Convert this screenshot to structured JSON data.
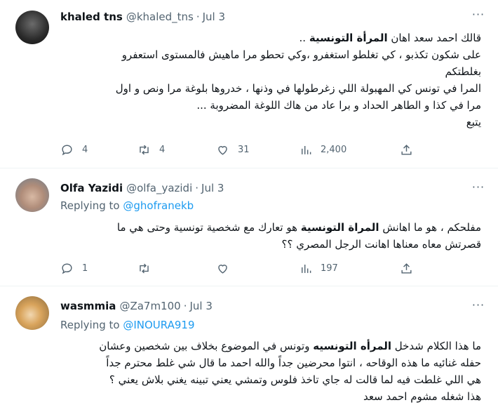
{
  "tweets": [
    {
      "name": "khaled tns",
      "handle": "@khaled_tns",
      "date": "Jul 3",
      "lines": [
        {
          "pre": "قالك احمد سعد اهان ",
          "bold": "المرأة التونسية",
          "post": " .."
        },
        {
          "pre": "على شكون تكذبو ، كي تغلطو استغفرو ،وكي تحطو مرا ماهيش فالمستوى استعفرو",
          "bold": "",
          "post": ""
        },
        {
          "pre": "بغلطتكم",
          "bold": "",
          "post": ""
        },
        {
          "pre": "المرا في تونس كي المهبولة اللي زغرطولها في وذنها ، خدروها بلوغة مرا ونص و اول",
          "bold": "",
          "post": ""
        },
        {
          "pre": "مرا في كذا و الطاهر الحداد و برا عاد من هاك اللوغة المضروبة ...",
          "bold": "",
          "post": ""
        },
        {
          "pre": "يتبع",
          "bold": "",
          "post": ""
        }
      ],
      "replies": "4",
      "retweets": "4",
      "likes": "31",
      "views": "2,400"
    },
    {
      "name": "Olfa Yazidi",
      "handle": "@olfa_yazidi",
      "date": "Jul 3",
      "replying_label": "Replying to",
      "replying_to": "@ghofranekb",
      "lines": [
        {
          "pre": "مفلحكم ، هو ما اهانش ",
          "bold": "المراة التونسية",
          "post": " هو تعارك مع شخصية تونسية وحتى هي ما"
        },
        {
          "pre": "قصرتش معاه معناها اهانت الرجل المصري ؟؟",
          "bold": "",
          "post": ""
        }
      ],
      "replies": "1",
      "retweets": "",
      "likes": "",
      "views": "197"
    },
    {
      "name": "wasmmia",
      "handle": "@Za7m100",
      "date": "Jul 3",
      "replying_label": "Replying to",
      "replying_to": "@INOURA919",
      "lines": [
        {
          "pre": "ما هذا الكلام شدخل ",
          "bold": "المرأه التونسيه",
          "post": " وتونس في الموضوع بخلاف بين شخصين وعشان"
        },
        {
          "pre": "حفله غنائيه ما هذه الوقاحه ، انتوا محرضين جداً والله احمد ما قال شي غلط محترم جداً",
          "bold": "",
          "post": ""
        },
        {
          "pre": "هي اللي غلطت فيه لما قالت له جاي تاخذ فلوس وتمشي يعني تبينه يغني بلاش يعني ؟",
          "bold": "",
          "post": ""
        },
        {
          "pre": "هذا شغله مشوم احمد سعد",
          "bold": "",
          "post": ""
        }
      ]
    }
  ]
}
